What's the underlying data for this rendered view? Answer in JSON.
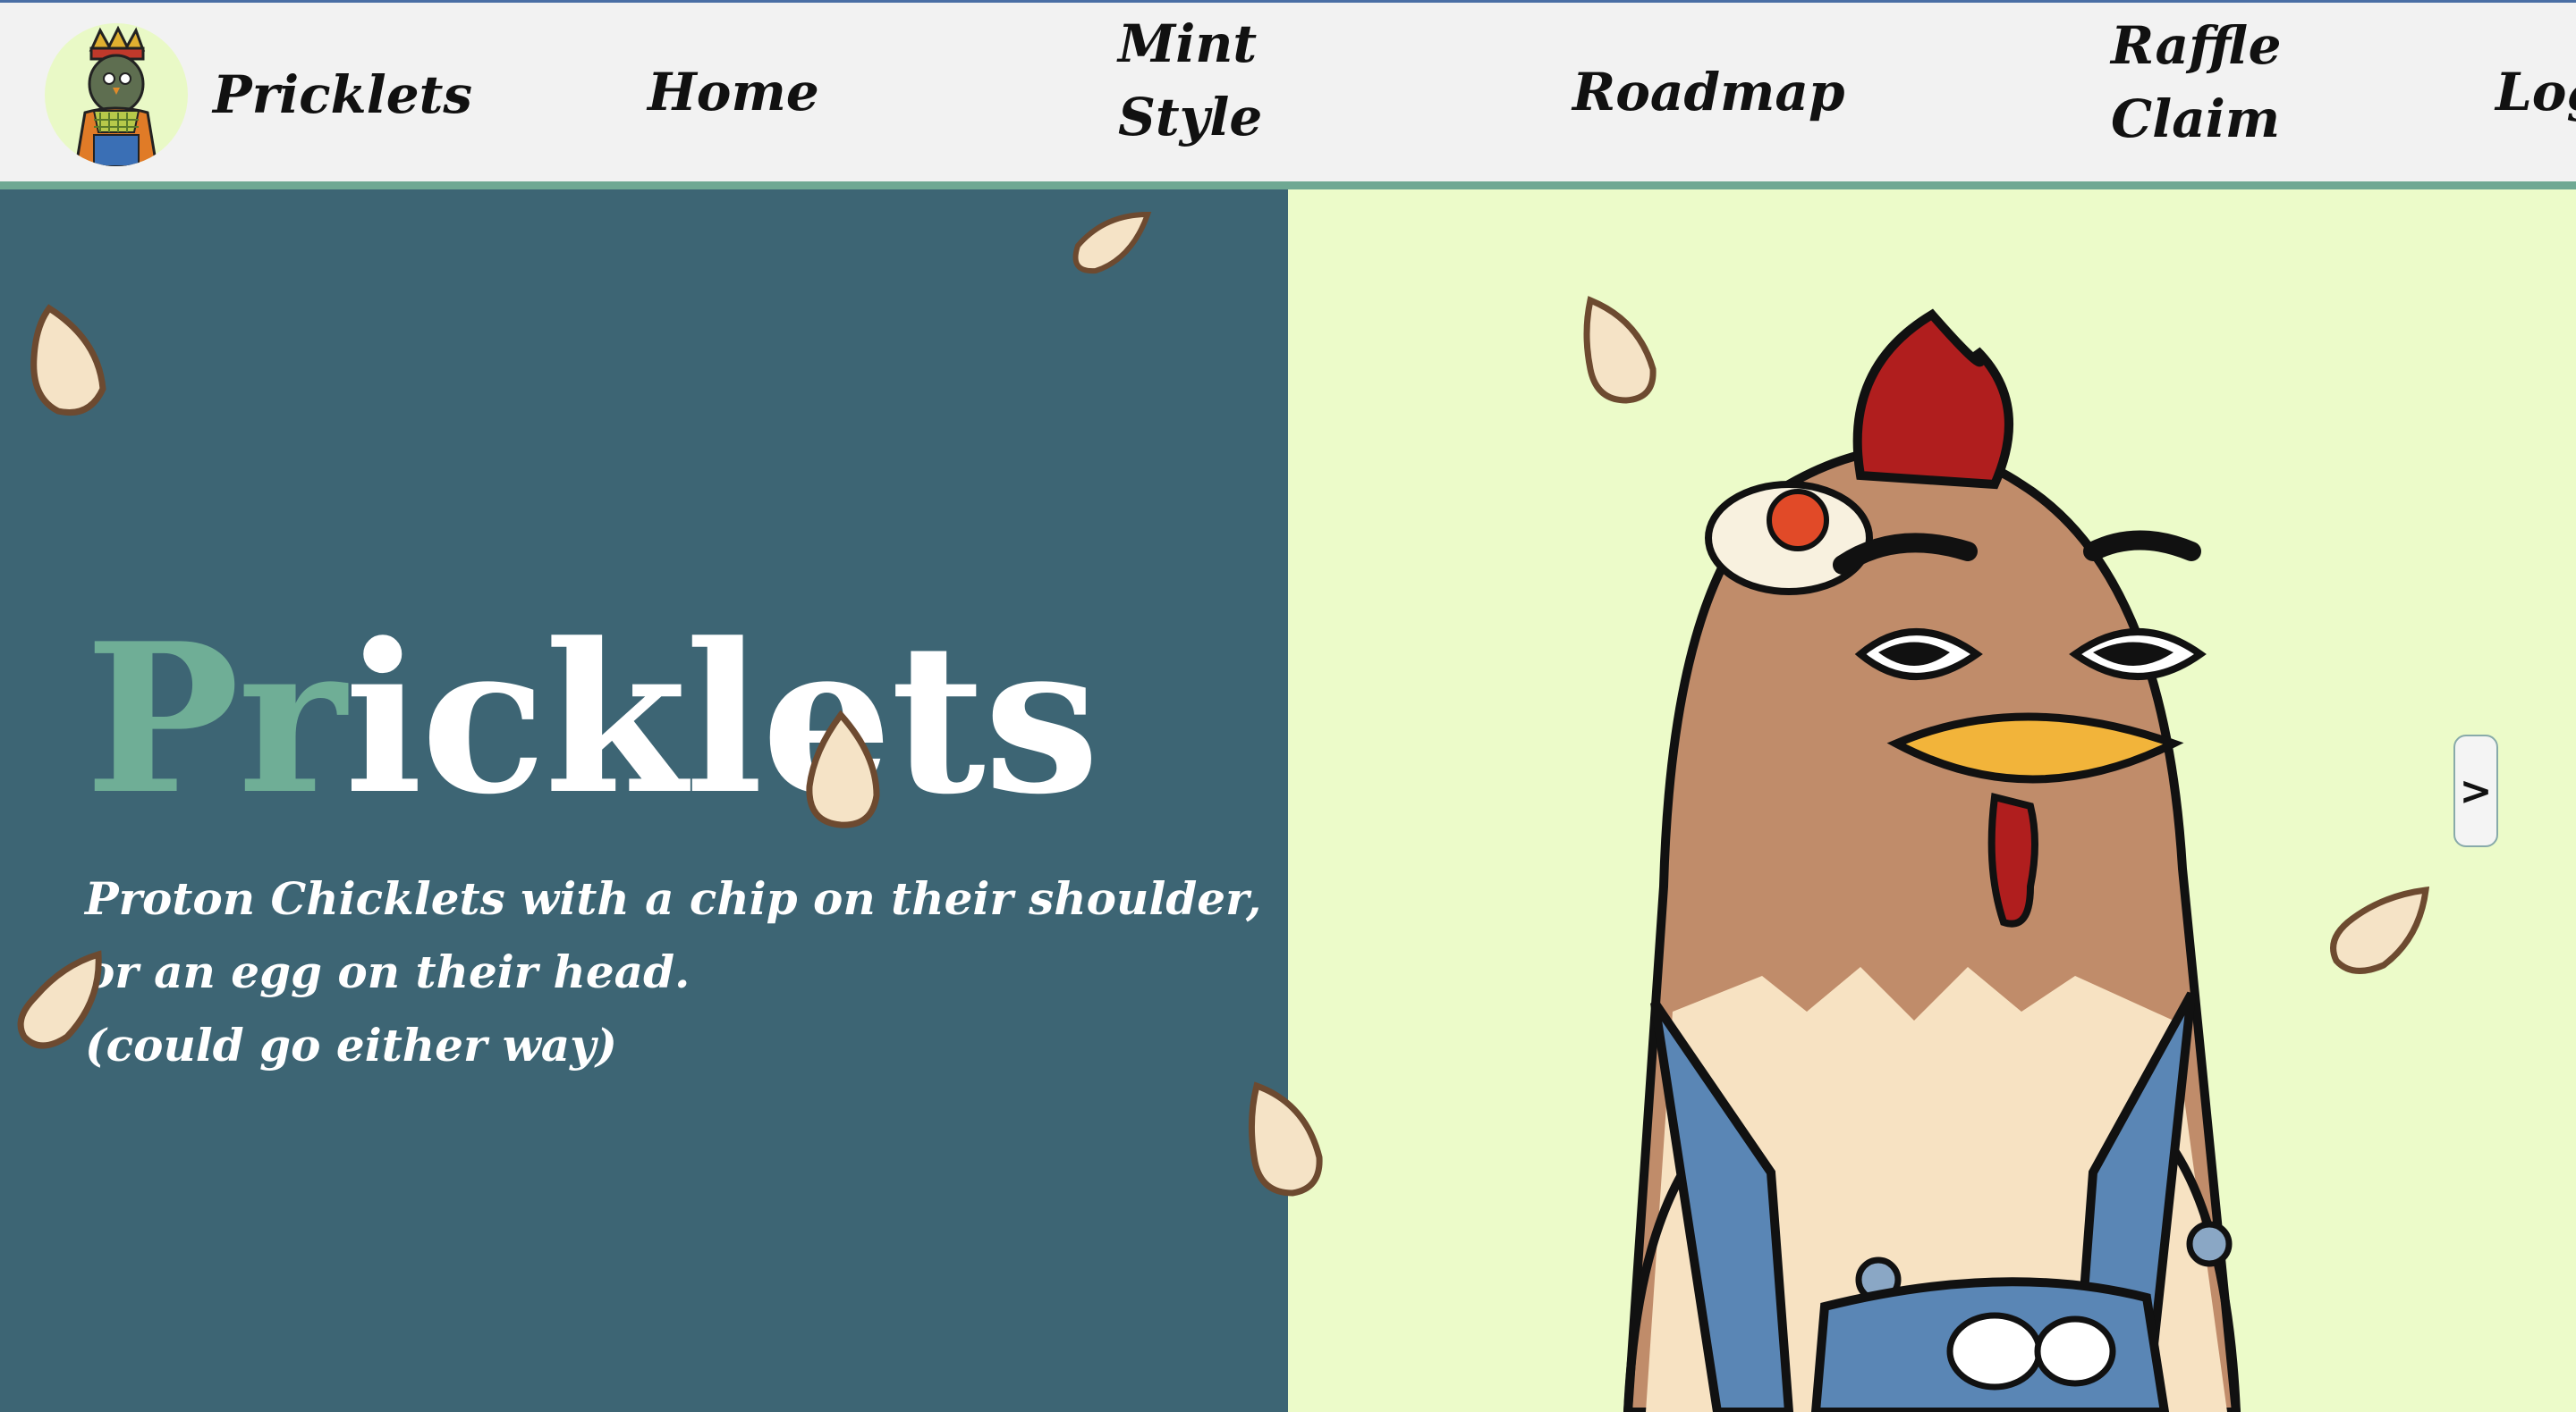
{
  "navbar": {
    "brand_name": "Pricklets",
    "home": "Home",
    "mint": "Mint",
    "style": "Style",
    "roadmap": "Roadmap",
    "raffle": "Raffle",
    "claim": "Claim",
    "login": "Logi"
  },
  "hero": {
    "title_accent": "Pr",
    "title_rest": "icklets",
    "subtitle_line1": "Proton Chicklets with a chip on their shoulder, or an egg on their head.",
    "subtitle_line2": "(could go either way)",
    "next_label": ">"
  },
  "colors": {
    "nav_bg": "#f2f2f2",
    "nav_border": "#6fa893",
    "hero_left_bg": "#3d6574",
    "hero_right_bg": "#ecfbc9",
    "title_accent": "#6fae96",
    "title_white": "#ffffff"
  },
  "icons": {
    "brand_logo": "crowned-bird-avatar",
    "seed": "sunflower-seed-icon",
    "next": "chevron-right-icon"
  }
}
